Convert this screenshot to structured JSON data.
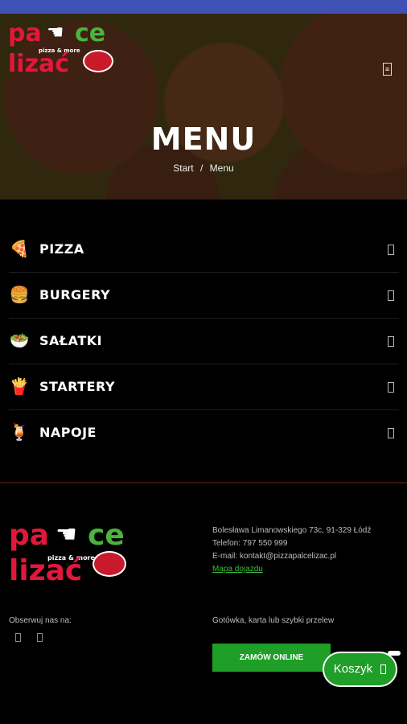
{
  "colors": {
    "status_bar": "#3f51b5",
    "brand_red": "#e2183b",
    "brand_green": "#49b53a",
    "button_green": "#1f9e28"
  },
  "hero": {
    "logo": {
      "line1a": "pa",
      "line1b": "ce",
      "line2": "lizać",
      "tagline": "pizza & more"
    },
    "title": "MENU",
    "breadcrumb": {
      "start": "Start",
      "sep": "/",
      "current": "Menu"
    },
    "menu_icon": "hamburger-icon"
  },
  "categories": [
    {
      "label": "PIZZA",
      "icon": "pizza-slice-icon",
      "glyph": "🍕"
    },
    {
      "label": "BURGERY",
      "icon": "burger-icon",
      "glyph": "🍔"
    },
    {
      "label": "SAŁATKI",
      "icon": "salad-icon",
      "glyph": "🥗"
    },
    {
      "label": "STARTERY",
      "icon": "fries-icon",
      "glyph": "🍟"
    },
    {
      "label": "NAPOJE",
      "icon": "drink-icon",
      "glyph": "🍹"
    }
  ],
  "footer": {
    "logo": {
      "line1a": "pa",
      "line1b": "ce",
      "line2": "lizać",
      "tagline": "pizza & more"
    },
    "address": "Bolesława Limanowskiego 73c, 91-329 Łódź",
    "phone": "Telefon: 797 550 999",
    "email": "E-mail: kontakt@pizzapalcelizac.pl",
    "map_link": "Mapa dojazdu",
    "follow": "Obserwuj nas na:",
    "payment": "Gotówka, karta lub szybki przelew",
    "order_button": "ZAMÓW ONLINE"
  },
  "cart": {
    "label": "Koszyk"
  }
}
